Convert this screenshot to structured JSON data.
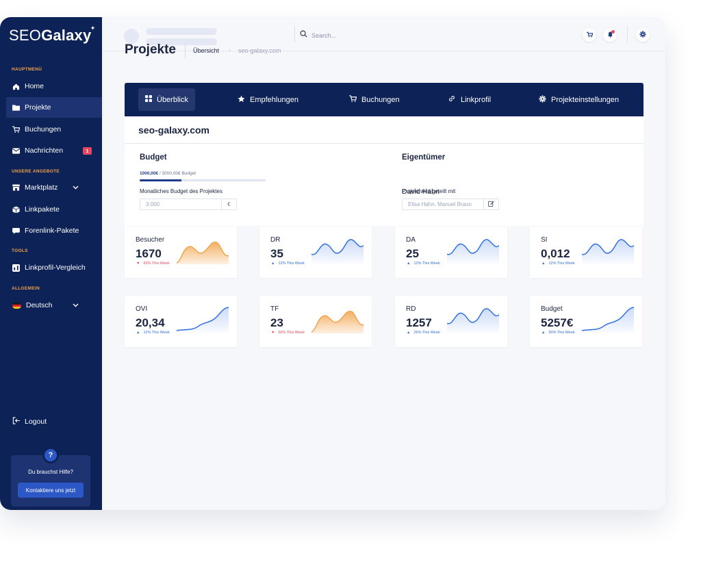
{
  "colors": {
    "sidebar": "#0d2256",
    "accent": "#2c57c6",
    "orange": "#f0a248",
    "up": "#2f6fe0",
    "down": "#e64560"
  },
  "logo": {
    "part1": "SEO",
    "part2": "Galaxy"
  },
  "sidebar": {
    "section_main": "HAUPTMENÜ",
    "section_offers": "UNSERE ANGEBOTE",
    "section_tools": "TOOLS",
    "section_general": "ALLGEMEIN",
    "items": [
      {
        "label": "Home",
        "icon": "home-icon"
      },
      {
        "label": "Projekte",
        "icon": "folder-icon"
      },
      {
        "label": "Buchungen",
        "icon": "cart-icon"
      },
      {
        "label": "Nachrichten",
        "icon": "mail-icon",
        "badge": "1"
      },
      {
        "label": "Marktplatz",
        "icon": "store-icon"
      },
      {
        "label": "Linkpakete",
        "icon": "package-icon"
      },
      {
        "label": "Forenlink-Pakete",
        "icon": "chat-icon"
      },
      {
        "label": "Linkprofil-Vergleich",
        "icon": "compare-icon"
      },
      {
        "label": "Deutsch",
        "icon": "flag-de-icon"
      }
    ],
    "logout": "Logout",
    "help_text": "Du brauchst Hilfe?",
    "help_button": "Kontaktiere uns jetzt"
  },
  "topbar": {
    "search_placeholder": "Search..."
  },
  "header": {
    "title": "Projekte",
    "crumb1": "Übersicht",
    "crumb2": "seo-galaxy.com"
  },
  "tabs": [
    {
      "label": "Überblick",
      "icon": "grid-icon"
    },
    {
      "label": "Empfehlungen",
      "icon": "star-icon"
    },
    {
      "label": "Buchungen",
      "icon": "cart-icon"
    },
    {
      "label": "Linkprofil",
      "icon": "link-icon"
    },
    {
      "label": "Projekteinstellungen",
      "icon": "gear-icon"
    }
  ],
  "project": {
    "name": "seo-galaxy.com",
    "budget_title": "Budget",
    "budget_used": "1000,00€",
    "budget_total": "/ 3000,00€ Budget",
    "budget_progress": 0.333,
    "monthly_label": "Monatliches Budget des Projektes",
    "monthly_value": "3.000",
    "currency": "€",
    "owner_title": "Eigentümer",
    "owner_name": "David Hahn",
    "shared_label": "Projekt wird geteilt mit",
    "shared_value": "Elisa Hahn, Manuel Braun"
  },
  "stats": [
    {
      "label": "Besucher",
      "value": "1670",
      "trend": "60% This Week",
      "dir": "down"
    },
    {
      "label": "DR",
      "value": "35",
      "trend": "12% This Week",
      "dir": "up"
    },
    {
      "label": "DA",
      "value": "25",
      "trend": "12% This Week",
      "dir": "up"
    },
    {
      "label": "SI",
      "value": "0,012",
      "trend": "12% This Week",
      "dir": "up"
    },
    {
      "label": "OVI",
      "value": "20,34",
      "trend": "12% This Week",
      "dir": "up"
    },
    {
      "label": "TF",
      "value": "23",
      "trend": "60% This Week",
      "dir": "down"
    },
    {
      "label": "RD",
      "value": "1257",
      "trend": "25% This Week",
      "dir": "up"
    },
    {
      "label": "Budget",
      "value": "5257€",
      "trend": "90% This Week",
      "dir": "up"
    }
  ]
}
